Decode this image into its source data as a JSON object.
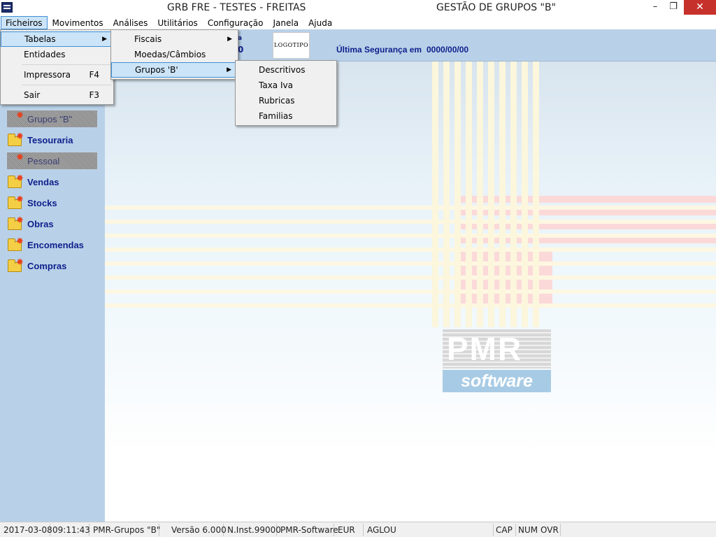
{
  "window": {
    "title_left": "GRB FRE - TESTES - FREITAS",
    "title_right": "GESTÃO DE GRUPOS \"B\"",
    "min_glyph": "–",
    "max_glyph": "❐",
    "close_glyph": "✕"
  },
  "menubar": [
    "Ficheiros",
    "Movimentos",
    "Análises",
    "Utilitários",
    "Configuração",
    "Janela",
    "Ajuda"
  ],
  "menu_ficheiros": {
    "tabelas": "Tabelas",
    "entidades": "Entidades",
    "impressora": "Impressora",
    "impressora_shortcut": "F4",
    "sair": "Sair",
    "sair_shortcut": "F3",
    "arrow": "▶"
  },
  "menu_tabelas": {
    "fiscais": "Fiscais",
    "moedas": "Moedas/Câmbios",
    "grupos": "Grupos 'B'"
  },
  "menu_grupos": [
    "Descritivos",
    "Taxa Iva",
    "Rubricas",
    "Familias"
  ],
  "header": {
    "frag_a": "a",
    "frag_b": "0",
    "logo_text": "LOGOTIPO",
    "backup_label": "Última Segurança em",
    "backup_value": "0000/00/00"
  },
  "sidebar": [
    {
      "label": "Grupos \"B\"",
      "disabled": true
    },
    {
      "label": "Tesouraria",
      "disabled": false
    },
    {
      "label": "Pessoal",
      "disabled": true
    },
    {
      "label": "Vendas",
      "disabled": false
    },
    {
      "label": "Stocks",
      "disabled": false
    },
    {
      "label": "Obras",
      "disabled": false
    },
    {
      "label": "Encomendas",
      "disabled": false
    },
    {
      "label": "Compras",
      "disabled": false
    }
  ],
  "brand": {
    "pmr": "PMR",
    "software": "software"
  },
  "statusbar": {
    "date": "2017-03-08",
    "time": "09:11:43",
    "module": "PMR-Grupos \"B\"",
    "version": "Versão  6.000",
    "install": "N.Inst.99000",
    "vendor": "PMR-Software",
    "currency": "EUR",
    "user": "AGLOU",
    "cap": "CAP",
    "num": "NUM",
    "ovr": "OVR"
  }
}
